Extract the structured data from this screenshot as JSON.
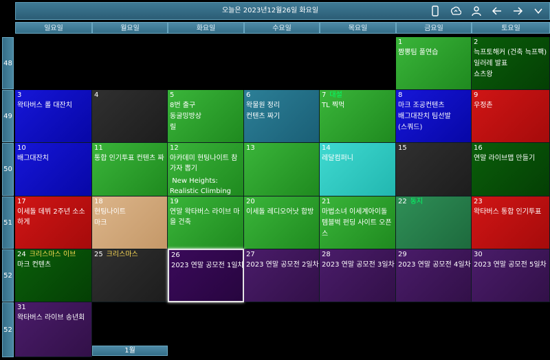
{
  "header": {
    "title": "오늘은 2023년12월26일 화요일",
    "icons": [
      "phone-icon",
      "sync-icon",
      "user-icon",
      "arrow-left-icon",
      "arrow-right-icon",
      "chevron-down-icon"
    ]
  },
  "weekdays": [
    "일요일",
    "월요일",
    "화요일",
    "수요일",
    "목요일",
    "금요일",
    "토요일"
  ],
  "weeks": [
    "48",
    "49",
    "50",
    "51",
    "52",
    "52"
  ],
  "month_label": "1월",
  "holiday_color": "#00ff66",
  "holiday_color_warm": "#ffdd55",
  "days": {
    "d1": {
      "date": "1",
      "events": [
        "짬뽕팀 풀연습"
      ]
    },
    "d2": {
      "date": "2",
      "events": [
        "늑프토해커 (건축 늑프팩)",
        "일러레 발표",
        "쇼츠왕"
      ]
    },
    "d3": {
      "date": "3",
      "events": [
        "왁타버스 롤 대잔치"
      ]
    },
    "d4": {
      "date": "4",
      "events": []
    },
    "d5": {
      "date": "5",
      "events": [
        "8번 출구",
        "동굴밍방상",
        "릴"
      ]
    },
    "d6": {
      "date": "6",
      "events": [
        "왁물원 정리",
        "컨텐츠 짜기"
      ]
    },
    "d7": {
      "date": "7",
      "holiday": "대설",
      "events": [
        "TL 찍먹"
      ]
    },
    "d8": {
      "date": "8",
      "events": [
        "마크 조공컨텐츠",
        "배그대잔치 팀선발",
        "(스쿼드)"
      ]
    },
    "d9": {
      "date": "9",
      "events": [
        "우정촌"
      ]
    },
    "d10": {
      "date": "10",
      "events": [
        "배그대잔치"
      ]
    },
    "d11": {
      "date": "11",
      "events": [
        "통합 인기투표 컨텐츠 짜"
      ]
    },
    "d12": {
      "date": "12",
      "events": [
        "아카데미 현팅나이트 참가자 뽑기",
        " New Heights: Realistic Climbing"
      ]
    },
    "d13": {
      "date": "13",
      "events": []
    },
    "d14": {
      "date": "14",
      "events": [
        "레달컴퍼니"
      ]
    },
    "d15": {
      "date": "15",
      "events": []
    },
    "d16": {
      "date": "16",
      "events": [
        "연말 라이브맵 만들기"
      ]
    },
    "d17": {
      "date": "17",
      "events": [
        "이세돌 데뷔 2주년 소소하게"
      ]
    },
    "d18": {
      "date": "18",
      "events": [
        "현팅나이트",
        "마크"
      ]
    },
    "d19": {
      "date": "19",
      "events": [
        "연말 왁타버스 라이브 마을 건축"
      ]
    },
    "d20": {
      "date": "20",
      "events": [
        "이세돌 레디오어낫 합방"
      ]
    },
    "d21": {
      "date": "21",
      "events": [
        "마법소녀 이세계아이돌",
        "템블벅 펀딩 사이트 오픈",
        "스"
      ]
    },
    "d22": {
      "date": "22",
      "holiday": "동지",
      "events": []
    },
    "d23": {
      "date": "23",
      "events": [
        "왁타버스 통합 인기투표"
      ]
    },
    "d24": {
      "date": "24",
      "holiday": "크리스마스 이브",
      "events": [
        "마크 컨텐츠"
      ]
    },
    "d25": {
      "date": "25",
      "holiday": "크리스마스",
      "events": []
    },
    "d26": {
      "date": "26",
      "events": [
        "2023 연말 공모전 1일차"
      ]
    },
    "d27": {
      "date": "27",
      "events": [
        "2023 연말 공모전 2일차"
      ]
    },
    "d28": {
      "date": "28",
      "events": [
        "2023 연말 공모전 3일차"
      ]
    },
    "d29": {
      "date": "29",
      "events": [
        "2023 연말 공모전 4일차"
      ]
    },
    "d30": {
      "date": "30",
      "events": [
        "2023 연말 공모전 5일차"
      ]
    },
    "d31": {
      "date": "31",
      "events": [
        "왁타버스 라이브 송년회"
      ]
    }
  }
}
